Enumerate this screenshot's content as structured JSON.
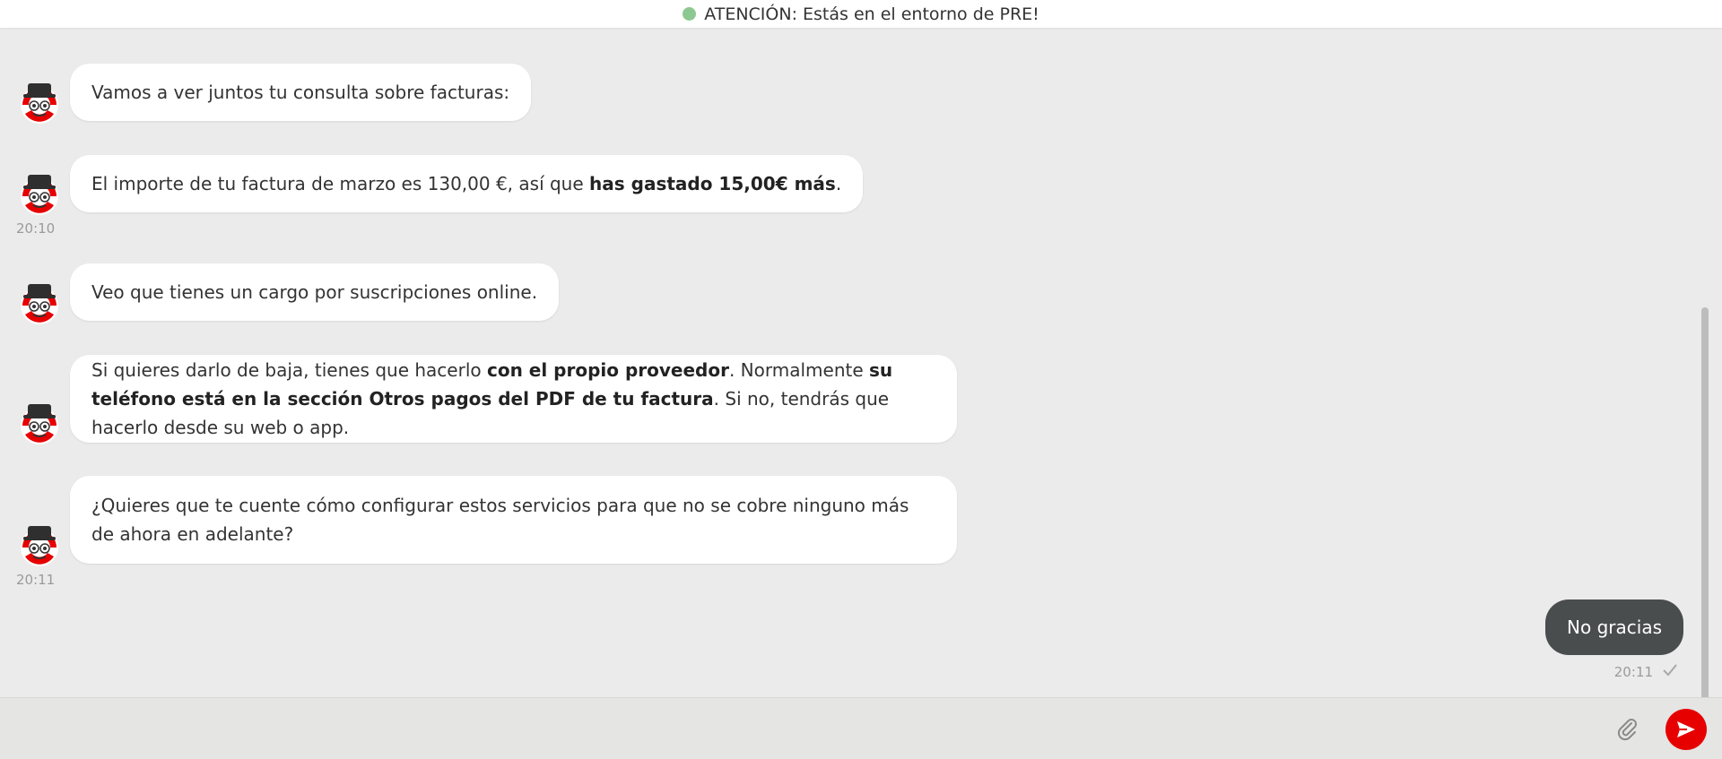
{
  "banner": {
    "text": "ATENCIÓN: Estás en el entorno de PRE!",
    "dot_color": "#8dc891"
  },
  "avatar_icon": "bot-avatar-icon",
  "messages": [
    {
      "segments": [
        {
          "t": "Vamos a ver juntos tu consulta sobre facturas:",
          "b": false
        }
      ],
      "time": ""
    },
    {
      "segments": [
        {
          "t": "El importe de tu factura de marzo es 130,00 €, así que ",
          "b": false
        },
        {
          "t": "has gastado 15,00€ más",
          "b": true
        },
        {
          "t": ".",
          "b": false
        }
      ],
      "time": "20:10"
    },
    {
      "segments": [
        {
          "t": "Veo que tienes un cargo por suscripciones online.",
          "b": false
        }
      ],
      "time": ""
    },
    {
      "segments": [
        {
          "t": "Si quieres darlo de baja, tienes que hacerlo ",
          "b": false
        },
        {
          "t": "con el propio proveedor",
          "b": true
        },
        {
          "t": ". Normalmente ",
          "b": false
        },
        {
          "t": "su teléfono está en la sección Otros pagos del PDF de tu factura",
          "b": true
        },
        {
          "t": ". Si no, tendrás que hacerlo desde su web o app.",
          "b": false
        }
      ],
      "time": ""
    },
    {
      "segments": [
        {
          "t": "¿Quieres que te cuente cómo configurar estos servicios para que no se cobre ninguno más de ahora en adelante?",
          "b": false
        }
      ],
      "time": "20:11"
    }
  ],
  "user_message": {
    "text": "No gracias",
    "time": "20:11",
    "status_icon": "checkmark-icon"
  },
  "composer": {
    "attach_icon": "paperclip-icon",
    "send_icon": "send-icon",
    "send_color": "#e60000"
  }
}
